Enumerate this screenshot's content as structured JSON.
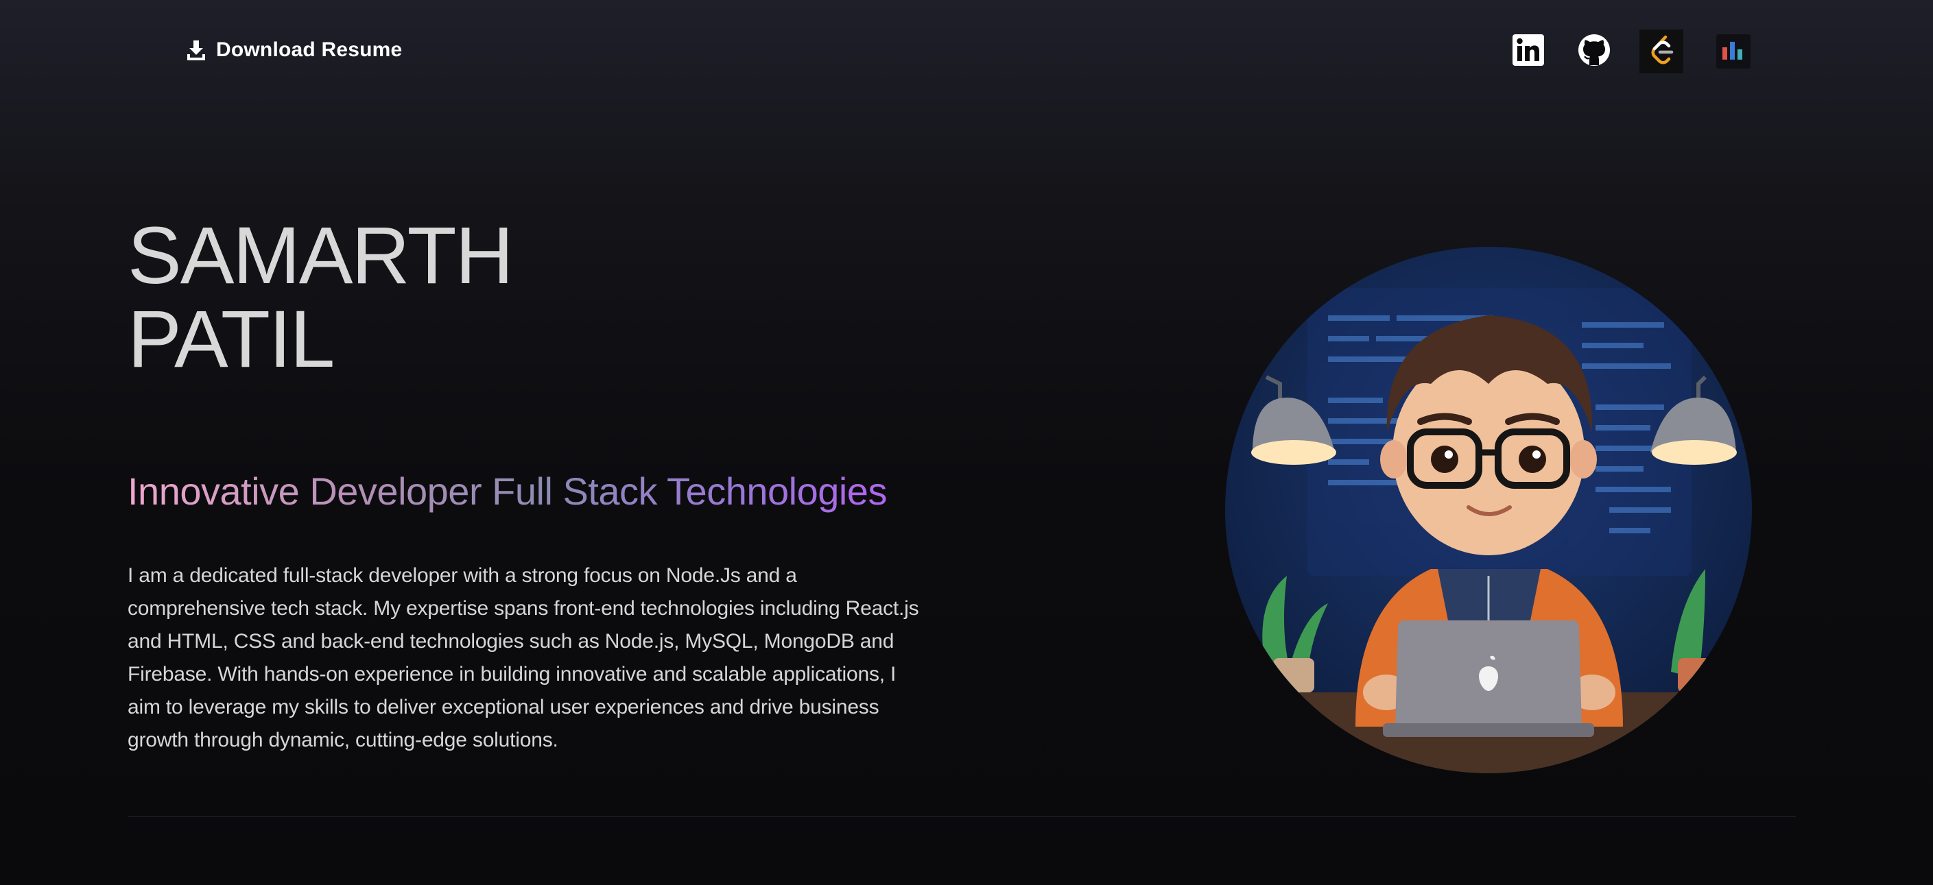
{
  "header": {
    "download_label": "Download Resume",
    "download_icon": "download-icon",
    "socials": [
      {
        "name": "linkedin",
        "icon": "linkedin-icon"
      },
      {
        "name": "github",
        "icon": "github-icon"
      },
      {
        "name": "leetcode",
        "icon": "leetcode-icon"
      },
      {
        "name": "stats",
        "icon": "bar-chart-icon"
      }
    ]
  },
  "hero": {
    "first_name": "SAMARTH",
    "last_name": "PATIL",
    "tagline": "Innovative Developer Full Stack Technologies",
    "bio": "I am a dedicated full-stack developer with a strong focus on Node.Js and a comprehensive tech stack. My expertise spans front-end technologies including React.js and HTML, CSS and back-end technologies such as Node.js, MySQL, MongoDB and Firebase. With hands-on experience in building innovative and scalable applications, I aim to leverage my skills to deliver exceptional user experiences and drive business growth through dynamic, cutting-edge solutions."
  },
  "colors": {
    "background": "#0a0a0c",
    "tagline_start": "#f0a8cf",
    "tagline_end": "#b066f0",
    "leetcode_orange": "#f0a020"
  }
}
